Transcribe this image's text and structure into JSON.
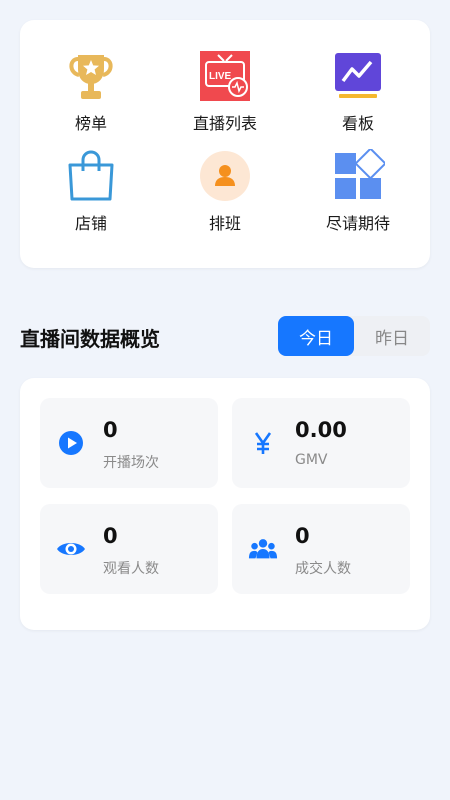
{
  "menu": {
    "items": [
      {
        "label": "榜单",
        "icon": "trophy-icon"
      },
      {
        "label": "直播列表",
        "icon": "live-tv-icon"
      },
      {
        "label": "看板",
        "icon": "dashboard-chart-icon"
      },
      {
        "label": "店铺",
        "icon": "shopping-bag-icon"
      },
      {
        "label": "排班",
        "icon": "person-avatar-icon"
      },
      {
        "label": "尽请期待",
        "icon": "more-apps-icon"
      }
    ],
    "live_badge": "LIVE"
  },
  "overview": {
    "title": "直播间数据概览",
    "tabs": {
      "today": "今日",
      "yesterday": "昨日",
      "selected": "today"
    }
  },
  "stats": {
    "sessions": {
      "value": "0",
      "label": "开播场次",
      "icon": "play-circle-icon"
    },
    "gmv": {
      "value": "0.00",
      "label": "GMV",
      "icon": "yen-icon"
    },
    "viewers": {
      "value": "0",
      "label": "观看人数",
      "icon": "eye-icon"
    },
    "buyers": {
      "value": "0",
      "label": "成交人数",
      "icon": "group-icon"
    }
  },
  "colors": {
    "accent": "#1677ff",
    "background": "#f0f4fb",
    "trophy": "#e8b85a",
    "live_red": "#f0494e"
  }
}
